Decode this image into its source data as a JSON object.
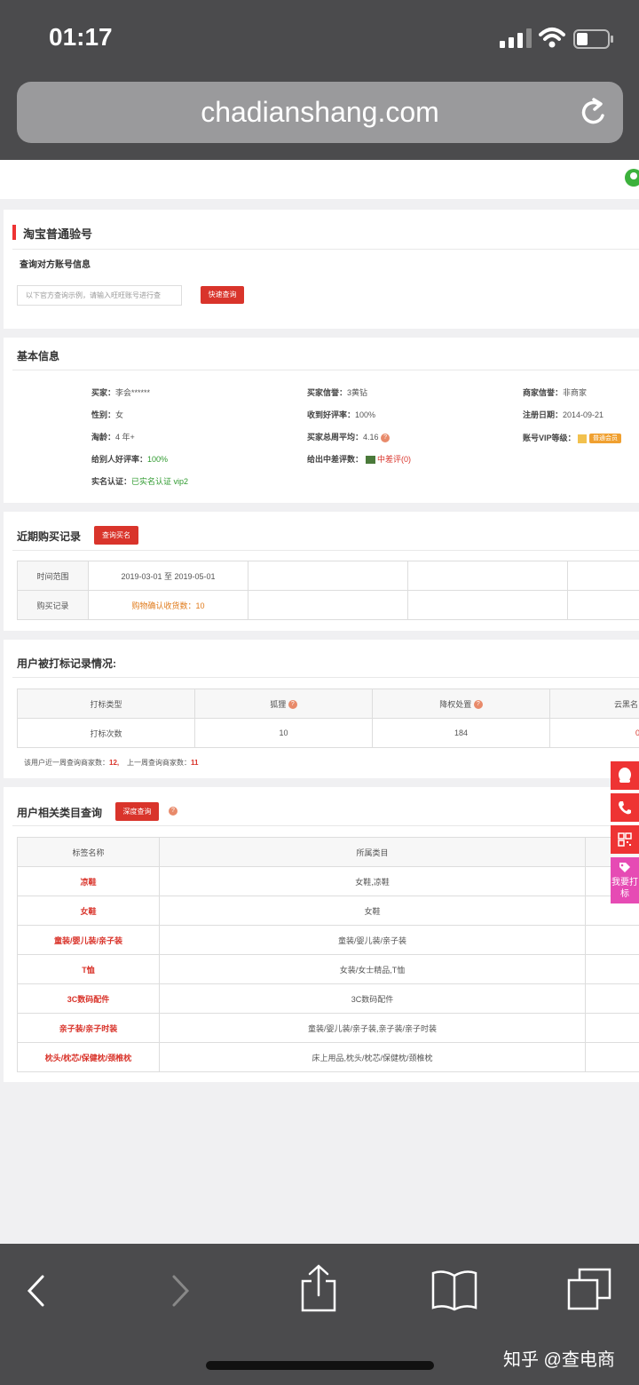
{
  "status": {
    "time": "01:17"
  },
  "browser": {
    "url": "chadianshang.com"
  },
  "card1": {
    "title": "淘宝普通验号",
    "subtitle": "查询对方账号信息",
    "placeholder": "以下官方查询示例，请输入旺旺账号进行查",
    "button": "快速查询"
  },
  "card2": {
    "title": "基本信息",
    "col1": [
      {
        "label": "买家：",
        "value": "李会******"
      },
      {
        "label": "性别：",
        "value": "女"
      },
      {
        "label": "淘龄：",
        "value": "4 年+"
      },
      {
        "label": "给别人好评率：",
        "value": "100%"
      },
      {
        "label": "实名认证：",
        "value": "已实名认证 vip2"
      }
    ],
    "col2": [
      {
        "label": "买家信誉：",
        "value": "3黄钻"
      },
      {
        "label": "收到好评率：",
        "value": "100%"
      },
      {
        "label": "买家总周平均：",
        "value": "4.16"
      },
      {
        "label": "给出中差评数：",
        "value": "中差评(0)"
      }
    ],
    "col3": [
      {
        "label": "商家信誉：",
        "value": "非商家"
      },
      {
        "label": "注册日期：",
        "value": "2014-09-21"
      },
      {
        "label": "账号VIP等级：",
        "value": "普通会员"
      }
    ]
  },
  "card3": {
    "title": "近期购买记录",
    "button": "查询买名",
    "row1": {
      "label": "时间范围",
      "value": "2019-03-01 至 2019-05-01"
    },
    "row2": {
      "label": "购买记录",
      "value": "购物确认收货数：10"
    }
  },
  "card4": {
    "title": "用户被打标记录情况:",
    "headers": [
      "打标类型",
      "狐狸",
      "降权处置",
      "云黑名"
    ],
    "row": [
      "打标次数",
      "10",
      "184",
      "0"
    ],
    "note_label1": "该用户近一周查询商家数：",
    "note_val1": "12,",
    "note_label2": "上一周查询商家数：",
    "note_val2": "11"
  },
  "card5": {
    "title": "用户相关类目查询",
    "button": "深度查询",
    "headers": [
      "标签名称",
      "所属类目"
    ],
    "rows": [
      [
        "凉鞋",
        "女鞋,凉鞋"
      ],
      [
        "女鞋",
        "女鞋"
      ],
      [
        "童装/婴儿装/亲子装",
        "童装/婴儿装/亲子装"
      ],
      [
        "T恤",
        "女装/女士精品,T恤"
      ],
      [
        "3C数码配件",
        "3C数码配件"
      ],
      [
        "亲子装/亲子时装",
        "童装/婴儿装/亲子装,亲子装/亲子时装"
      ],
      [
        "枕头/枕芯/保健枕/颈椎枕",
        "床上用品,枕头/枕芯/保健枕/颈椎枕"
      ]
    ]
  },
  "floating": {
    "tag_label": "我要打标"
  },
  "watermark": "知乎 @查电商"
}
